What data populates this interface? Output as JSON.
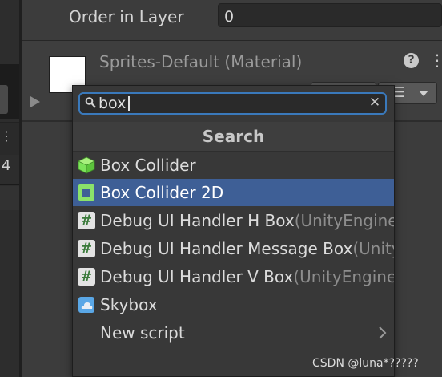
{
  "inspector": {
    "order_in_layer_label": "Order in Layer",
    "order_in_layer_value": "0",
    "material_title": "Sprites-Default (Material)"
  },
  "popup": {
    "search_value": "box",
    "header": "Search",
    "items": [
      {
        "label": "Box Collider",
        "namespace": "",
        "icon": "box-collider-icon",
        "selected": false
      },
      {
        "label": "Box Collider 2D",
        "namespace": "",
        "icon": "box-collider-2d-icon",
        "selected": true
      },
      {
        "label": "Debug UI Handler H Box",
        "namespace": "(UnityEngine.",
        "icon": "script-hash-icon",
        "selected": false
      },
      {
        "label": "Debug UI Handler Message Box",
        "namespace": "(Unity",
        "icon": "script-hash-icon",
        "selected": false
      },
      {
        "label": "Debug UI Handler V Box",
        "namespace": "(UnityEngine.I",
        "icon": "script-hash-icon",
        "selected": false
      },
      {
        "label": "Skybox",
        "namespace": "",
        "icon": "skybox-icon",
        "selected": false
      },
      {
        "label": "New script",
        "namespace": "",
        "icon": "",
        "selected": false
      }
    ]
  },
  "left_panel": {
    "number": "4"
  },
  "watermark": "CSDN @luna*?????",
  "colors": {
    "selection": "#3e5f96",
    "search_focus": "#3a79bb",
    "box_collider_green": "#7ce35a",
    "script_hash_green": "#3a7a3a"
  }
}
